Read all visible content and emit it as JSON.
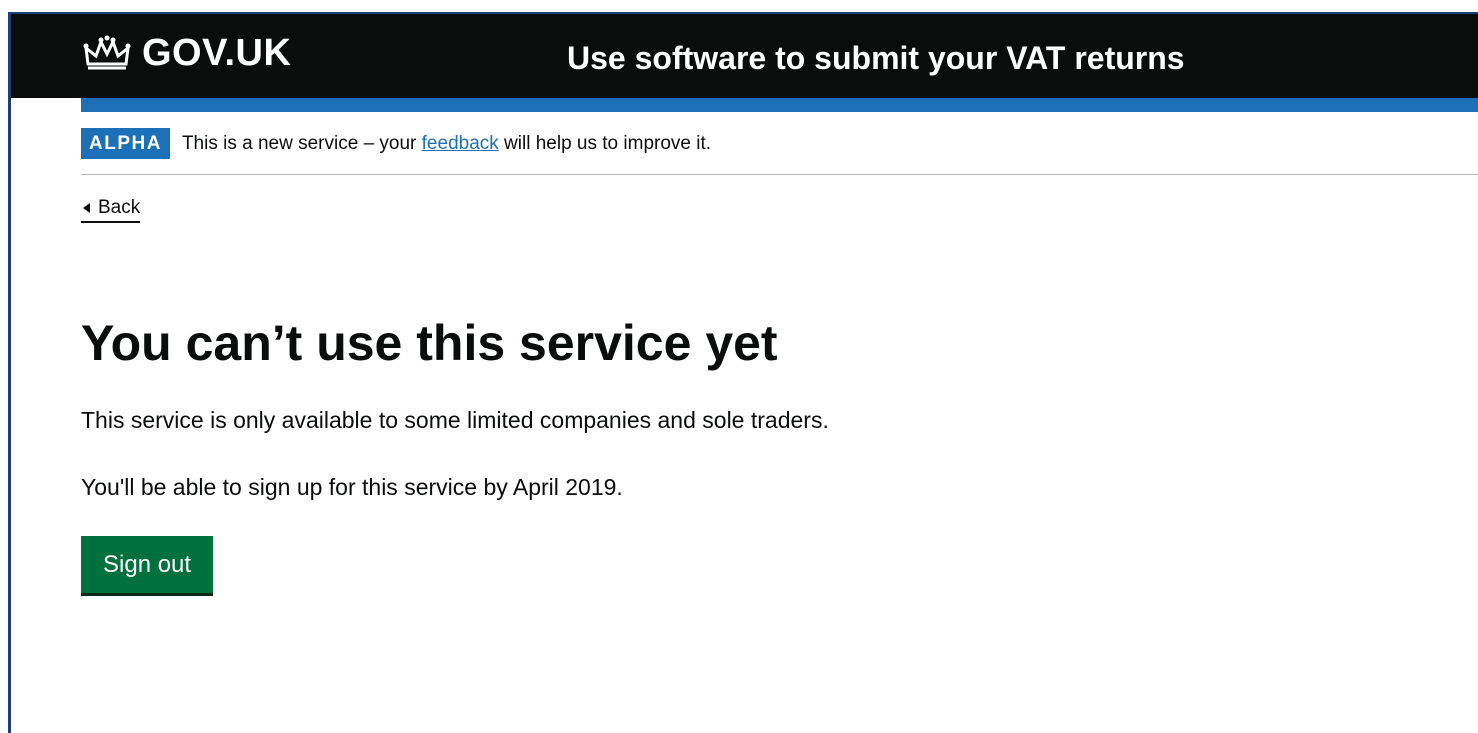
{
  "header": {
    "logo_text": "GOV.UK",
    "logo_icon": "crown-icon",
    "service_name": "Use software to submit your VAT returns"
  },
  "phase_banner": {
    "tag": "ALPHA",
    "text_before": "This is a new service – your ",
    "link_text": "feedback",
    "text_after": " will help us to improve it."
  },
  "back_link": {
    "label": "Back",
    "icon": "back-arrow-icon"
  },
  "main": {
    "title": "You can’t use this service yet",
    "paragraphs": [
      "This service is only available to some limited companies and sole traders.",
      "You'll be able to sign up for this service by April 2019."
    ],
    "sign_out_label": "Sign out"
  },
  "colors": {
    "header_bg": "#0b0c0c",
    "brand_blue": "#1d70b8",
    "button_green": "#00703c",
    "text": "#0b0c0c"
  }
}
